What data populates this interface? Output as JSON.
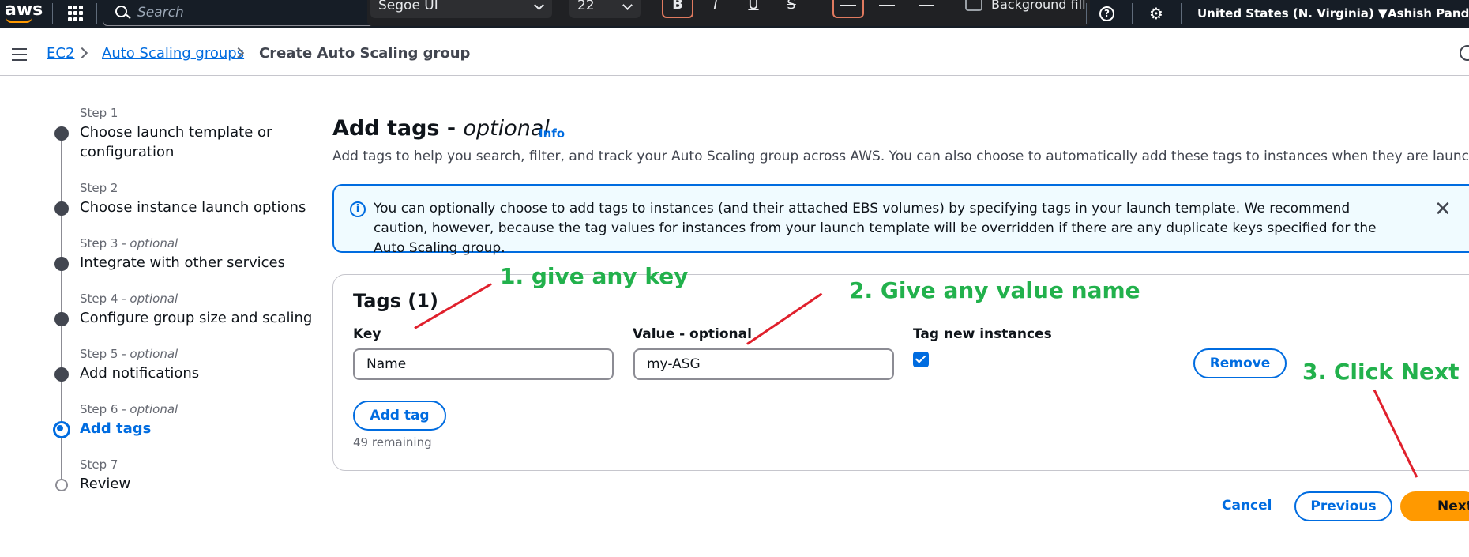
{
  "topnav": {
    "logo": "aws",
    "search_placeholder": "Search",
    "region": "United States (N. Virginia) ▼",
    "account": "Ashish Pandey"
  },
  "format_toolbar": {
    "font": "Segoe UI",
    "size": "22",
    "bold": "B",
    "italic": "I",
    "underline": "U",
    "strike": "S",
    "background_label": "Background fill"
  },
  "breadcrumb": {
    "items": [
      "EC2",
      "Auto Scaling groups",
      "Create Auto Scaling group"
    ]
  },
  "steps": [
    {
      "num": "Step 1",
      "optional": "",
      "title": "Choose launch template or configuration",
      "state": "done"
    },
    {
      "num": "Step 2",
      "optional": "",
      "title": "Choose instance launch options",
      "state": "done"
    },
    {
      "num": "Step 3",
      "optional": "optional",
      "title": "Integrate with other services",
      "state": "done"
    },
    {
      "num": "Step 4",
      "optional": "optional",
      "title": "Configure group size and scaling",
      "state": "done"
    },
    {
      "num": "Step 5",
      "optional": "optional",
      "title": "Add notifications",
      "state": "done"
    },
    {
      "num": "Step 6",
      "optional": "optional",
      "title": "Add tags",
      "state": "active"
    },
    {
      "num": "Step 7",
      "optional": "",
      "title": "Review",
      "state": "todo"
    }
  ],
  "main": {
    "title": "Add tags - ",
    "title_optional": "optional",
    "info": "Info",
    "description": "Add tags to help you search, filter, and track your Auto Scaling group across AWS. You can also choose to automatically add these tags to instances when they are launched.",
    "alert_text": "You can optionally choose to add tags to instances (and their attached EBS volumes) by specifying tags in your launch template. We recommend caution, however, because the tag values for instances from your launch template will be overridden if there are any duplicate keys specified for the Auto Scaling group.",
    "tags": {
      "title": "Tags (1)",
      "key_label": "Key",
      "value_label": "Value - optional",
      "tag_new_label": "Tag new instances",
      "rows": [
        {
          "key": "Name",
          "value": "my-ASG",
          "tag_new_instances": true
        }
      ],
      "remove_label": "Remove",
      "add_tag_label": "Add tag",
      "remaining": "49 remaining"
    },
    "footer": {
      "cancel": "Cancel",
      "previous": "Previous",
      "next": "Next"
    }
  },
  "annotations": {
    "a1": "1. give any key",
    "a2": "2. Give any value name",
    "a3": "3. Click Next",
    "text_color": "#22b14c",
    "arrow_color": "#e0202c"
  },
  "colors": {
    "nav_bg": "#161d26",
    "accent": "#006ce0",
    "primary_button": "#ff9900"
  }
}
